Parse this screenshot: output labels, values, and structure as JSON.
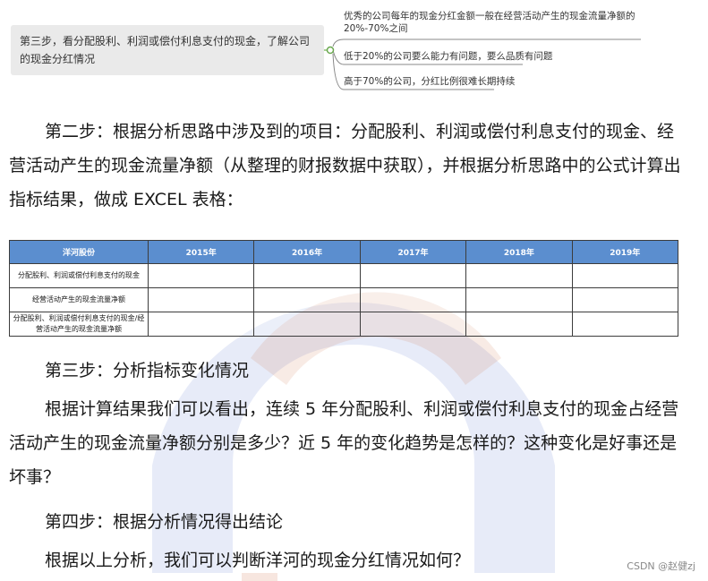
{
  "mindmap": {
    "node": "第三步，看分配股利、利润或偿付利息支付的现金，了解公司的现金分红情况",
    "branches": [
      "优秀的公司每年的现金分红金额一般在经营活动产生的现金流量净额的20%-70%之间",
      "低于20%的公司要么能力有问题，要么品质有问题",
      "高于70%的公司，分红比例很难长期持续"
    ]
  },
  "para1": "第二步：根据分析思路中涉及到的项目：分配股利、利润或偿付利息支付的现金、经营活动产生的现金流量净额（从整理的财报数据中获取），并根据分析思路中的公式计算出指标结果，做成 EXCEL 表格：",
  "table": {
    "headers": [
      "洋河股份",
      "2015年",
      "2016年",
      "2017年",
      "2018年",
      "2019年"
    ],
    "rows": [
      "分配股利、利润或偿付利息支付的现金",
      "经营活动产生的现金流量净额",
      "分配股利、利润或偿付利息支付的现金/经营活动产生的现金流量净额"
    ]
  },
  "step3": "第三步：分析指标变化情况",
  "para2": "根据计算结果我们可以看出，连续 5 年分配股利、利润或偿付利息支付的现金占经营活动产生的现金流量净额分别是多少？近 5 年的变化趋势是怎样的？这种变化是好事还是坏事？",
  "step4": "第四步：根据分析情况得出结论",
  "final": "根据以上分析，我们可以判断洋河的现金分红情况如何？",
  "watermark_text": "CSDN @赵健zj",
  "colors": {
    "header": "#5b8ecf",
    "mindmap_node": "#eaeaea"
  }
}
